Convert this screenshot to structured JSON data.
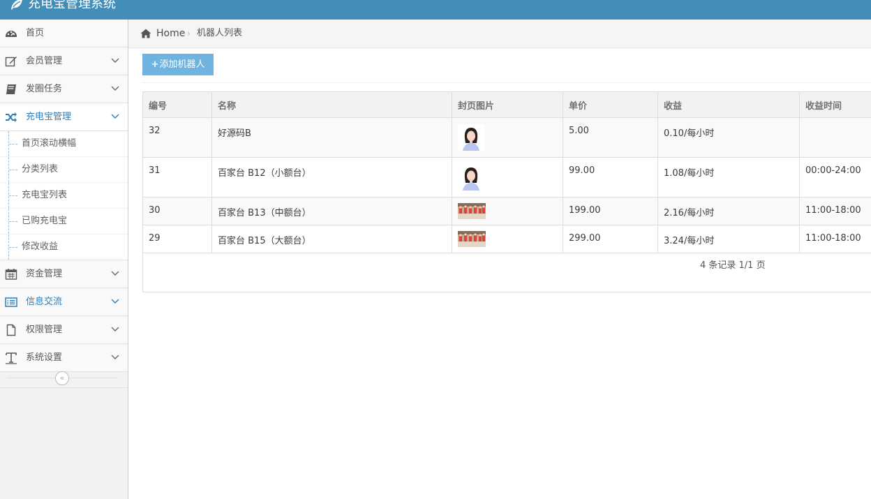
{
  "app": {
    "title": "充电宝管理系统"
  },
  "sidebar": {
    "items": [
      {
        "label": "首页"
      },
      {
        "label": "会员管理"
      },
      {
        "label": "发圈任务"
      },
      {
        "label": "充电宝管理"
      },
      {
        "label": "资金管理"
      },
      {
        "label": "信息交流"
      },
      {
        "label": "权限管理"
      },
      {
        "label": "系统设置"
      }
    ],
    "submenu": [
      "首页滚动横幅",
      "分类列表",
      "充电宝列表",
      "已购充电宝",
      "修改收益"
    ],
    "collapse_glyph": "«"
  },
  "breadcrumb": {
    "home": "Home",
    "separator": "›",
    "current": "机器人列表"
  },
  "toolbar": {
    "add_label": "添加机器人",
    "add_icon": "+"
  },
  "table": {
    "columns": [
      "编号",
      "名称",
      "封页图片",
      "单价",
      "收益",
      "收益时间"
    ],
    "rows": [
      {
        "id": "32",
        "name": "好源码B",
        "image": "portrait",
        "price": "5.00",
        "income": "0.10/每小时",
        "time": ""
      },
      {
        "id": "31",
        "name": "百家台 B12（小额台）",
        "image": "portrait",
        "price": "99.00",
        "income": "1.08/每小时",
        "time": "00:00-24:00"
      },
      {
        "id": "30",
        "name": "百家台 B13（中额台）",
        "image": "group-photo",
        "price": "199.00",
        "income": "2.16/每小时",
        "time": "11:00-18:00"
      },
      {
        "id": "29",
        "name": "百家台 B15（大额台）",
        "image": "group-photo",
        "price": "299.00",
        "income": "3.24/每小时",
        "time": "11:00-18:00"
      }
    ]
  },
  "pager": {
    "text": "4 条记录 1/1 页"
  },
  "colors": {
    "topbar": "#438eb9",
    "accent": "#2b7dbc",
    "button": "#6fb3e0"
  }
}
